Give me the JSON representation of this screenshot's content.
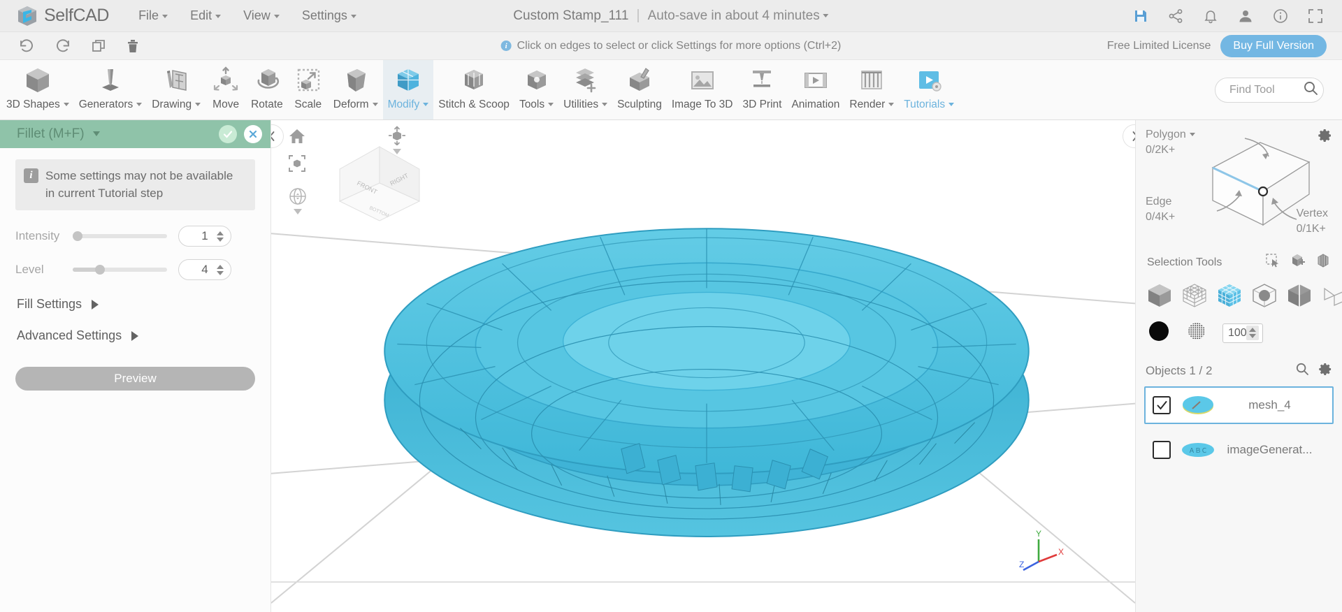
{
  "menubar": {
    "brand": "SelfCAD",
    "items": [
      {
        "label": "File",
        "caret": true
      },
      {
        "label": "Edit",
        "caret": true
      },
      {
        "label": "View",
        "caret": true
      },
      {
        "label": "Settings",
        "caret": true
      }
    ],
    "doc_name": "Custom Stamp_111",
    "separator": "|",
    "autosave": "Auto-save in about 4 minutes",
    "icons": [
      "save-icon",
      "share-icon",
      "bell-icon",
      "user-icon",
      "info-icon",
      "fullscreen-icon"
    ]
  },
  "tipbar": {
    "undo_icon": "undo-icon",
    "redo_icon": "redo-icon",
    "copy_icon": "copy-icon",
    "delete_icon": "trash-icon",
    "info_glyph": "i",
    "tip": "Click on edges to select or click Settings for more options (Ctrl+2)",
    "license": "Free Limited License",
    "buy_label": "Buy Full Version",
    "buy_color": "#73b7e3"
  },
  "ribbon": {
    "tools": [
      {
        "label": "3D Shapes",
        "caret": true,
        "icon": "cube-icon",
        "active": false,
        "highlight": false
      },
      {
        "label": "Generators",
        "caret": true,
        "icon": "generator-icon",
        "active": false,
        "highlight": false
      },
      {
        "label": "Drawing",
        "caret": true,
        "icon": "pencil-sketch-icon",
        "active": false,
        "highlight": false
      },
      {
        "label": "Move",
        "caret": false,
        "icon": "move-icon",
        "active": false,
        "highlight": false
      },
      {
        "label": "Rotate",
        "caret": false,
        "icon": "rotate-icon",
        "active": false,
        "highlight": false
      },
      {
        "label": "Scale",
        "caret": false,
        "icon": "scale-icon",
        "active": false,
        "highlight": false
      },
      {
        "label": "Deform",
        "caret": true,
        "icon": "deform-icon",
        "active": false,
        "highlight": false
      },
      {
        "label": "Modify",
        "caret": true,
        "icon": "modify-icon",
        "active": true,
        "highlight": true
      },
      {
        "label": "Stitch & Scoop",
        "caret": false,
        "icon": "stitch-scoop-icon",
        "active": false,
        "highlight": false
      },
      {
        "label": "Tools",
        "caret": true,
        "icon": "tools-icon",
        "active": false,
        "highlight": false
      },
      {
        "label": "Utilities",
        "caret": true,
        "icon": "utilities-icon",
        "active": false,
        "highlight": false
      },
      {
        "label": "Sculpting",
        "caret": false,
        "icon": "sculpting-icon",
        "active": false,
        "highlight": false
      },
      {
        "label": "Image To 3D",
        "caret": false,
        "icon": "image-to-3d-icon",
        "active": false,
        "highlight": false
      },
      {
        "label": "3D Print",
        "caret": false,
        "icon": "3d-print-icon",
        "active": false,
        "highlight": false
      },
      {
        "label": "Animation",
        "caret": false,
        "icon": "animation-icon",
        "active": false,
        "highlight": false
      },
      {
        "label": "Render",
        "caret": true,
        "icon": "render-icon",
        "active": false,
        "highlight": false
      },
      {
        "label": "Tutorials",
        "caret": true,
        "icon": "tutorials-icon",
        "active": false,
        "highlight": true
      }
    ],
    "find_placeholder": "Find Tool",
    "find_value": ""
  },
  "left_panel": {
    "title": "Fillet (M+F)",
    "confirm_icon": "check-icon",
    "cancel_icon": "close-icon",
    "info_glyph": "i",
    "info_text": "Some settings may not be available in current Tutorial step",
    "params": [
      {
        "label": "Intensity",
        "value": "1",
        "fill_pct": 0,
        "knob_pct": 0
      },
      {
        "label": "Level",
        "value": "4",
        "fill_pct": 28,
        "knob_pct": 28
      }
    ],
    "sections": [
      {
        "label": "Fill Settings"
      },
      {
        "label": "Advanced Settings"
      }
    ],
    "preview_label": "Preview"
  },
  "viewport": {
    "collapse_left_icon": "chevron-left-icon",
    "collapse_right_icon": "chevron-right-icon",
    "tools": [
      "home-icon",
      "zoom-to-fit-icon"
    ],
    "orbit_icon": "orbit-icon",
    "perspective_icon": "perspective-icon",
    "viewcube": {
      "front": "FRONT",
      "right": "RIGHT",
      "bottom": "BOTTOM"
    },
    "axes": {
      "x": "X",
      "y": "Y",
      "z": "Z",
      "x_color": "#e03b3b",
      "y_color": "#3faa3f",
      "z_color": "#3b63e0"
    },
    "model_color": "#4ec3e0"
  },
  "right_panel": {
    "gear_icon": "gear-icon",
    "counts": [
      {
        "label": "Polygon",
        "value": "0/2K+",
        "caret": true
      },
      {
        "label": "Edge",
        "value": "0/4K+",
        "caret": false
      },
      {
        "label": "Vertex",
        "value": "0/1K+",
        "caret": false
      }
    ],
    "selection_tools_label": "Selection Tools",
    "selection_mini_icons": [
      "rect-select-icon",
      "add-select-icon",
      "loop-select-icon"
    ],
    "selection_mode_icons": [
      "select-object-icon",
      "select-wireframe-icon",
      "select-polygon-icon",
      "select-sphere-icon",
      "select-face-icon",
      "select-plane-icon"
    ],
    "selection_mode_active_index": 2,
    "brush_solid_icon": "brush-solid-icon",
    "brush_soft_icon": "brush-soft-icon",
    "brush_size": "100",
    "objects_title": "Objects 1 / 2",
    "objects_search_icon": "search-icon",
    "objects_gear_icon": "gear-icon",
    "objects": [
      {
        "name": "mesh_4",
        "checked": true,
        "selected": true,
        "thumb": "disc-thumb"
      },
      {
        "name": "imageGenerat...",
        "checked": false,
        "selected": false,
        "thumb": "text-thumb"
      }
    ]
  }
}
